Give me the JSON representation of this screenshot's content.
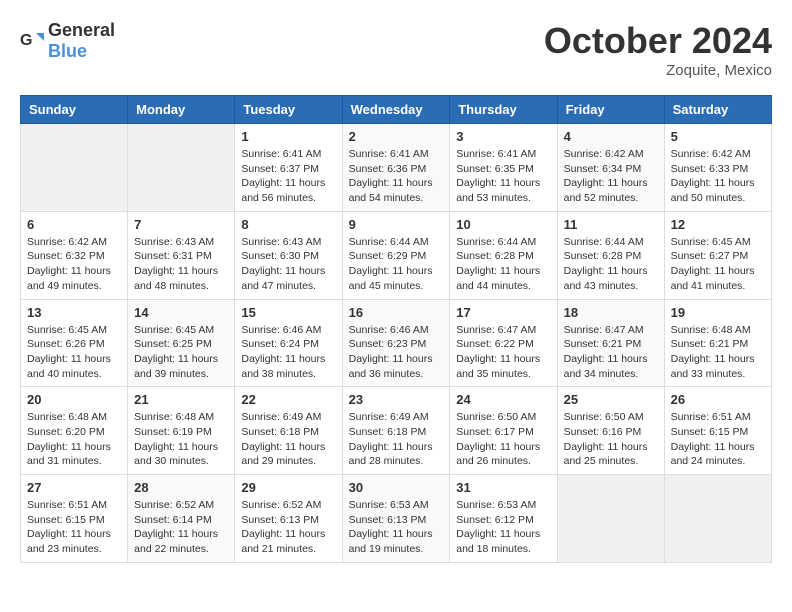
{
  "header": {
    "logo": {
      "general": "General",
      "blue": "Blue"
    },
    "title": "October 2024",
    "location": "Zoquite, Mexico"
  },
  "calendar": {
    "days_of_week": [
      "Sunday",
      "Monday",
      "Tuesday",
      "Wednesday",
      "Thursday",
      "Friday",
      "Saturday"
    ],
    "weeks": [
      [
        {
          "day": "",
          "info": ""
        },
        {
          "day": "",
          "info": ""
        },
        {
          "day": "1",
          "info": "Sunrise: 6:41 AM\nSunset: 6:37 PM\nDaylight: 11 hours and 56 minutes."
        },
        {
          "day": "2",
          "info": "Sunrise: 6:41 AM\nSunset: 6:36 PM\nDaylight: 11 hours and 54 minutes."
        },
        {
          "day": "3",
          "info": "Sunrise: 6:41 AM\nSunset: 6:35 PM\nDaylight: 11 hours and 53 minutes."
        },
        {
          "day": "4",
          "info": "Sunrise: 6:42 AM\nSunset: 6:34 PM\nDaylight: 11 hours and 52 minutes."
        },
        {
          "day": "5",
          "info": "Sunrise: 6:42 AM\nSunset: 6:33 PM\nDaylight: 11 hours and 50 minutes."
        }
      ],
      [
        {
          "day": "6",
          "info": "Sunrise: 6:42 AM\nSunset: 6:32 PM\nDaylight: 11 hours and 49 minutes."
        },
        {
          "day": "7",
          "info": "Sunrise: 6:43 AM\nSunset: 6:31 PM\nDaylight: 11 hours and 48 minutes."
        },
        {
          "day": "8",
          "info": "Sunrise: 6:43 AM\nSunset: 6:30 PM\nDaylight: 11 hours and 47 minutes."
        },
        {
          "day": "9",
          "info": "Sunrise: 6:44 AM\nSunset: 6:29 PM\nDaylight: 11 hours and 45 minutes."
        },
        {
          "day": "10",
          "info": "Sunrise: 6:44 AM\nSunset: 6:28 PM\nDaylight: 11 hours and 44 minutes."
        },
        {
          "day": "11",
          "info": "Sunrise: 6:44 AM\nSunset: 6:28 PM\nDaylight: 11 hours and 43 minutes."
        },
        {
          "day": "12",
          "info": "Sunrise: 6:45 AM\nSunset: 6:27 PM\nDaylight: 11 hours and 41 minutes."
        }
      ],
      [
        {
          "day": "13",
          "info": "Sunrise: 6:45 AM\nSunset: 6:26 PM\nDaylight: 11 hours and 40 minutes."
        },
        {
          "day": "14",
          "info": "Sunrise: 6:45 AM\nSunset: 6:25 PM\nDaylight: 11 hours and 39 minutes."
        },
        {
          "day": "15",
          "info": "Sunrise: 6:46 AM\nSunset: 6:24 PM\nDaylight: 11 hours and 38 minutes."
        },
        {
          "day": "16",
          "info": "Sunrise: 6:46 AM\nSunset: 6:23 PM\nDaylight: 11 hours and 36 minutes."
        },
        {
          "day": "17",
          "info": "Sunrise: 6:47 AM\nSunset: 6:22 PM\nDaylight: 11 hours and 35 minutes."
        },
        {
          "day": "18",
          "info": "Sunrise: 6:47 AM\nSunset: 6:21 PM\nDaylight: 11 hours and 34 minutes."
        },
        {
          "day": "19",
          "info": "Sunrise: 6:48 AM\nSunset: 6:21 PM\nDaylight: 11 hours and 33 minutes."
        }
      ],
      [
        {
          "day": "20",
          "info": "Sunrise: 6:48 AM\nSunset: 6:20 PM\nDaylight: 11 hours and 31 minutes."
        },
        {
          "day": "21",
          "info": "Sunrise: 6:48 AM\nSunset: 6:19 PM\nDaylight: 11 hours and 30 minutes."
        },
        {
          "day": "22",
          "info": "Sunrise: 6:49 AM\nSunset: 6:18 PM\nDaylight: 11 hours and 29 minutes."
        },
        {
          "day": "23",
          "info": "Sunrise: 6:49 AM\nSunset: 6:18 PM\nDaylight: 11 hours and 28 minutes."
        },
        {
          "day": "24",
          "info": "Sunrise: 6:50 AM\nSunset: 6:17 PM\nDaylight: 11 hours and 26 minutes."
        },
        {
          "day": "25",
          "info": "Sunrise: 6:50 AM\nSunset: 6:16 PM\nDaylight: 11 hours and 25 minutes."
        },
        {
          "day": "26",
          "info": "Sunrise: 6:51 AM\nSunset: 6:15 PM\nDaylight: 11 hours and 24 minutes."
        }
      ],
      [
        {
          "day": "27",
          "info": "Sunrise: 6:51 AM\nSunset: 6:15 PM\nDaylight: 11 hours and 23 minutes."
        },
        {
          "day": "28",
          "info": "Sunrise: 6:52 AM\nSunset: 6:14 PM\nDaylight: 11 hours and 22 minutes."
        },
        {
          "day": "29",
          "info": "Sunrise: 6:52 AM\nSunset: 6:13 PM\nDaylight: 11 hours and 21 minutes."
        },
        {
          "day": "30",
          "info": "Sunrise: 6:53 AM\nSunset: 6:13 PM\nDaylight: 11 hours and 19 minutes."
        },
        {
          "day": "31",
          "info": "Sunrise: 6:53 AM\nSunset: 6:12 PM\nDaylight: 11 hours and 18 minutes."
        },
        {
          "day": "",
          "info": ""
        },
        {
          "day": "",
          "info": ""
        }
      ]
    ]
  }
}
